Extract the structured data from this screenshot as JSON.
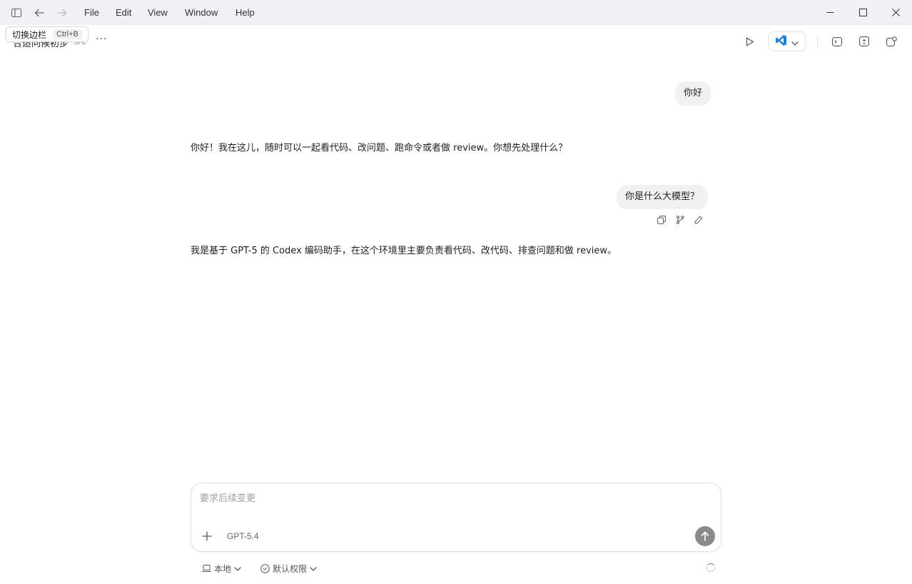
{
  "titlebar": {
    "menu": [
      "File",
      "Edit",
      "View",
      "Window",
      "Help"
    ],
    "icons": {
      "sidebar": "sidebar-toggle-icon",
      "back": "arrow-left-icon",
      "forward": "arrow-right-icon",
      "minimize": "minimize-icon",
      "maximize": "maximize-icon",
      "close": "close-icon"
    }
  },
  "tooltip": {
    "label": "切换边栏",
    "shortcut": "Ctrl+B"
  },
  "header": {
    "project_title": "合适问候初步",
    "project_sub": "src",
    "more": "···",
    "icons": [
      "play-icon",
      "vscode-icon",
      "terminal-icon",
      "diff-icon",
      "new-window-icon"
    ]
  },
  "conversation": [
    {
      "role": "user",
      "text": "你好"
    },
    {
      "role": "assistant",
      "text": "你好！我在这儿，随时可以一起看代码、改问题、跑命令或者做 review。你想先处理什么？"
    },
    {
      "role": "user",
      "text": "你是什么大模型？"
    },
    {
      "role": "assistant",
      "text": "我是基于 GPT-5 的 Codex 编码助手，在这个环境里主要负责看代码、改代码、排查问题和做 review。"
    }
  ],
  "message_actions": [
    "copy-icon",
    "branch-icon",
    "edit-icon"
  ],
  "composer": {
    "placeholder": "要求后续变更",
    "value": "",
    "model": "GPT-5.4"
  },
  "footer": {
    "environment": "本地",
    "permissions": "默认权限"
  },
  "colors": {
    "titlebar_bg": "#eff1f5",
    "bubble_bg": "#f1f1f1",
    "send_btn": "#8a8a8a",
    "vscode_blue": "#1e7fd6"
  }
}
